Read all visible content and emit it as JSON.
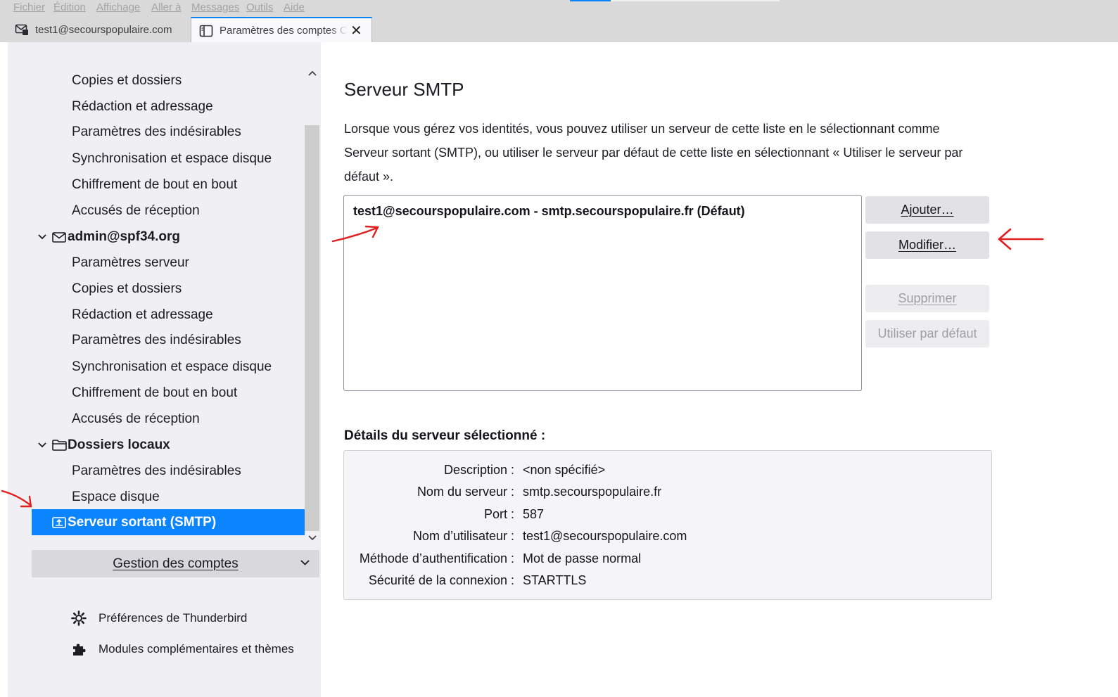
{
  "menubar": {
    "items": [
      "Fichier",
      "Édition",
      "Affichage",
      "Aller à",
      "Messages",
      "Outils",
      "Aide"
    ]
  },
  "tabs": {
    "mail_label": "test1@secourspopulaire.com",
    "settings_label": "Paramètres des comptes Co",
    "close_icon": "close-icon"
  },
  "sidebar": {
    "items": [
      "Copies et dossiers",
      "Rédaction et adressage",
      "Paramètres des indésirables",
      "Synchronisation et espace disque",
      "Chiffrement de bout en bout",
      "Accusés de réception"
    ],
    "account2": {
      "name": "admin@spf34.org",
      "items": [
        "Paramètres serveur",
        "Copies et dossiers",
        "Rédaction et adressage",
        "Paramètres des indésirables",
        "Synchronisation et espace disque",
        "Chiffrement de bout en bout",
        "Accusés de réception"
      ]
    },
    "local": {
      "name": "Dossiers locaux",
      "items": [
        "Paramètres des indésirables",
        "Espace disque"
      ]
    },
    "selected": "Serveur sortant (SMTP)",
    "manage_label": "Gestion des comptes",
    "prefs_label": "Préférences de Thunderbird",
    "addons_label": "Modules complémentaires et thèmes",
    "accent_color": "#0a84ff"
  },
  "main": {
    "title": "Serveur SMTP",
    "intro": "Lorsque vous gérez vos identités, vous pouvez utiliser un serveur de cette liste en le sélectionnant comme Serveur sortant (SMTP), ou utiliser le serveur par défaut de cette liste en sélectionnant « Utiliser le serveur par défaut ».",
    "server_entry": "test1@secourspopulaire.com - smtp.secourspopulaire.fr (Défaut)",
    "buttons": {
      "add": "Ajouter…",
      "edit": "Modifier…",
      "delete": "Supprimer",
      "set_default": "Utiliser par défaut"
    },
    "details_title": "Détails du serveur sélectionné :",
    "details": {
      "description_label": "Description :",
      "description_value": "<non spécifié>",
      "server_label": "Nom du serveur :",
      "server_value": "smtp.secourspopulaire.fr",
      "port_label": "Port :",
      "port_value": "587",
      "user_label": "Nom d’utilisateur :",
      "user_value": "test1@secourspopulaire.com",
      "auth_label": "Méthode d’authentification :",
      "auth_value": "Mot de passe normal",
      "security_label": "Sécurité de la connexion :",
      "security_value": "STARTTLS"
    }
  },
  "annotation_color": "#e02020"
}
